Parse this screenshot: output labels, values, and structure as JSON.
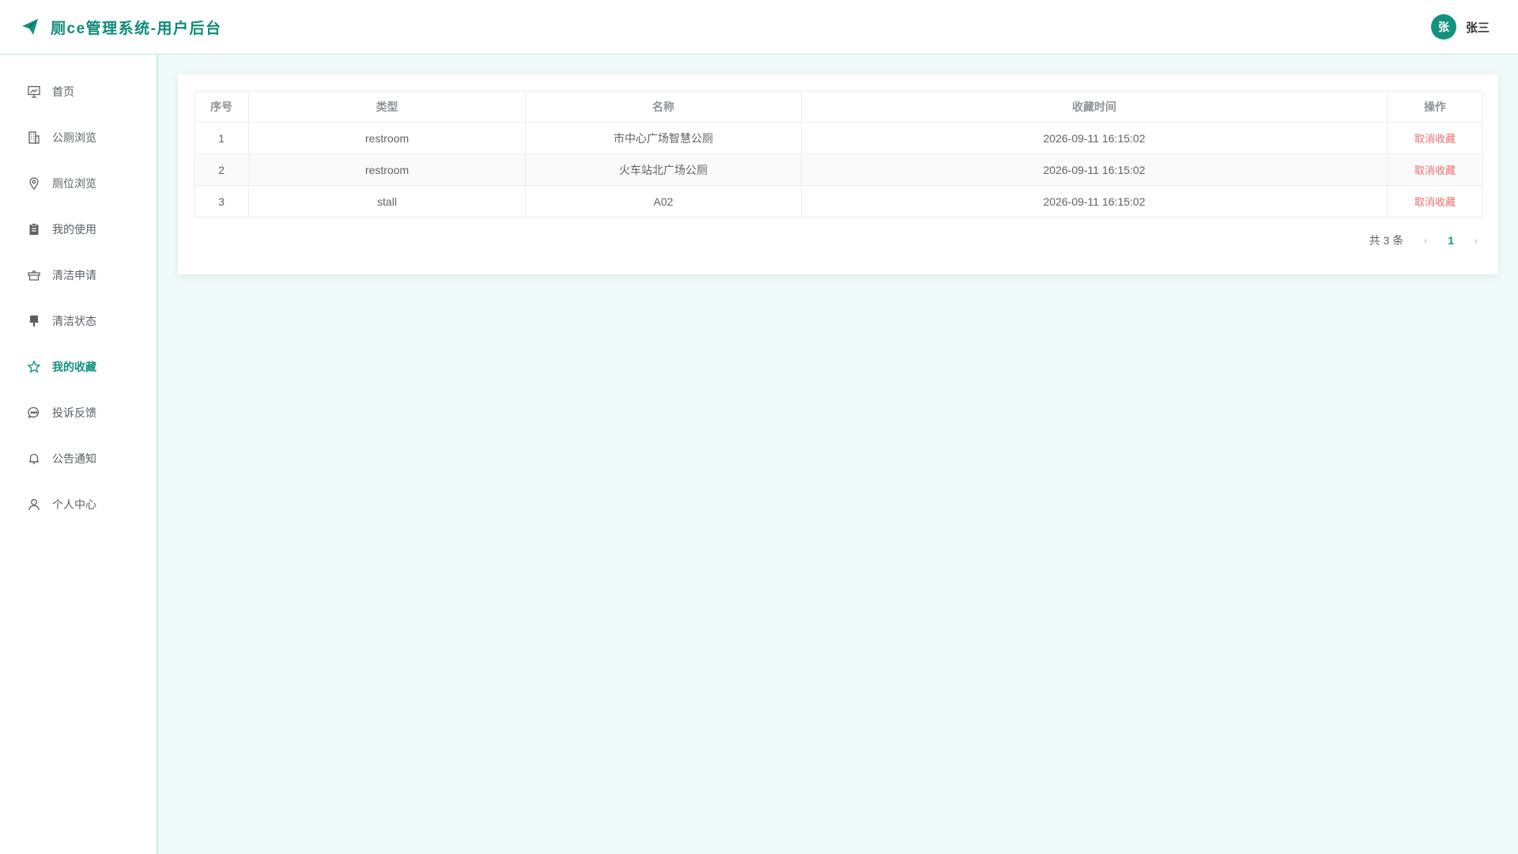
{
  "header": {
    "title": "厕ce管理系统-用户后台",
    "avatar_text": "张",
    "user_name": "张三"
  },
  "sidebar": {
    "items": [
      {
        "label": "首页",
        "icon": "presentation-icon"
      },
      {
        "label": "公厕浏览",
        "icon": "building-icon"
      },
      {
        "label": "厕位浏览",
        "icon": "location-pin-icon"
      },
      {
        "label": "我的使用",
        "icon": "clipboard-icon"
      },
      {
        "label": "清洁申请",
        "icon": "box-icon"
      },
      {
        "label": "清洁状态",
        "icon": "brush-icon"
      },
      {
        "label": "我的收藏",
        "icon": "star-icon",
        "active": true
      },
      {
        "label": "投诉反馈",
        "icon": "chat-bubble-icon"
      },
      {
        "label": "公告通知",
        "icon": "bell-icon"
      },
      {
        "label": "个人中心",
        "icon": "user-icon"
      }
    ]
  },
  "table": {
    "columns": [
      "序号",
      "类型",
      "名称",
      "收藏时间",
      "操作"
    ],
    "rows": [
      {
        "index": "1",
        "type": "restroom",
        "name": "市中心广场智慧公厕",
        "time": "2026-09-11 16:15:02",
        "action": "取消收藏"
      },
      {
        "index": "2",
        "type": "restroom",
        "name": "火车站北广场公厕",
        "time": "2026-09-11 16:15:02",
        "action": "取消收藏"
      },
      {
        "index": "3",
        "type": "stall",
        "name": "A02",
        "time": "2026-09-11 16:15:02",
        "action": "取消收藏"
      }
    ]
  },
  "pagination": {
    "total_text": "共 3 条",
    "current_page": "1",
    "prev": "‹",
    "next": "›"
  },
  "colors": {
    "accent": "#13927f",
    "danger": "#f56c6c",
    "page_bg": "#f0fbf9"
  }
}
